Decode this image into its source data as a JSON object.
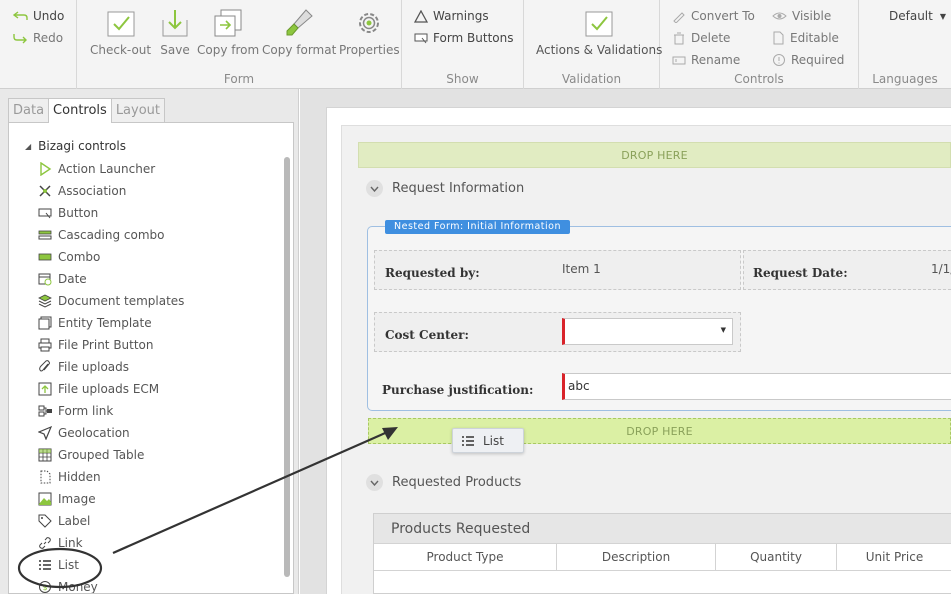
{
  "ribbon": {
    "undo": "Undo",
    "redo": "Redo",
    "form_group": {
      "label": "Form",
      "buttons": [
        "Check-out",
        "Save",
        "Copy from",
        "Copy format",
        "Properties"
      ]
    },
    "show_group": {
      "label": "Show",
      "warnings": "Warnings",
      "form_buttons": "Form Buttons"
    },
    "validation_group": {
      "label": "Validation",
      "actions": "Actions & Validations"
    },
    "controls_group": {
      "label": "Controls",
      "convert_to": "Convert To",
      "delete": "Delete",
      "rename": "Rename",
      "visible": "Visible",
      "editable": "Editable",
      "required": "Required"
    },
    "languages_group": {
      "label": "Languages",
      "selected": "Default"
    }
  },
  "left_panel": {
    "tabs": [
      "Data",
      "Controls",
      "Layout"
    ],
    "active_tab": "Controls",
    "root": "Bizagi controls",
    "items": [
      "Action Launcher",
      "Association",
      "Button",
      "Cascading combo",
      "Combo",
      "Date",
      "Document templates",
      "Entity Template",
      "File Print Button",
      "File uploads",
      "File uploads ECM",
      "Form link",
      "Geolocation",
      "Grouped Table",
      "Hidden",
      "Image",
      "Label",
      "Link",
      "List",
      "Money"
    ]
  },
  "form": {
    "drop_here": "DROP HERE",
    "section_request": "Request Information",
    "nested_label": "Nested Form: Initial Information",
    "requested_by_label": "Requested by:",
    "requested_by_value": "Item 1",
    "request_date_label": "Request Date:",
    "request_date_value": "1/1/",
    "cost_center_label": "Cost Center:",
    "purchase_label": "Purchase justification:",
    "purchase_value": "abc",
    "drag_ghost": "List",
    "section_products": "Requested Products",
    "grid_title": "Products Requested",
    "grid_columns": [
      "Product Type",
      "Description",
      "Quantity",
      "Unit Price"
    ]
  },
  "colors": {
    "accent": "#8dc63f",
    "nested_blue": "#3f8fe0",
    "required_red": "#d9232a",
    "drop_green": "#dbf0a4"
  }
}
